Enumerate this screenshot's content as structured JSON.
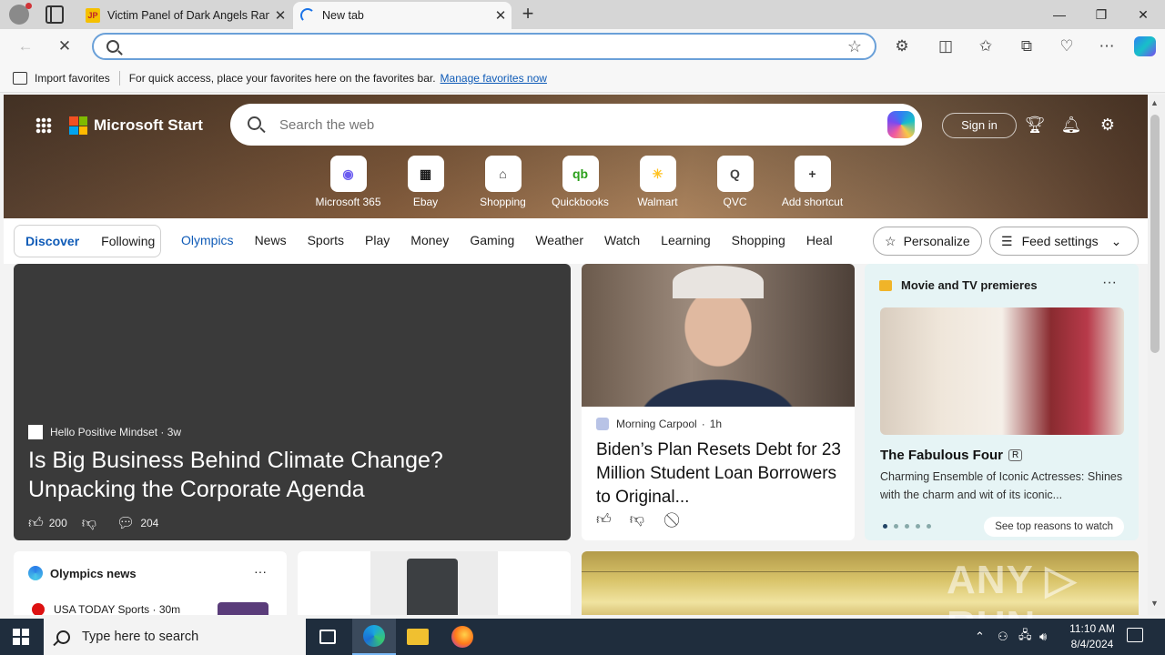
{
  "browser": {
    "tabs": [
      {
        "title": "Victim Panel of Dark Angels Ran",
        "favicon": "jp-favicon"
      },
      {
        "title": "New tab",
        "favicon": "loading-icon"
      }
    ],
    "address": {
      "value": "",
      "placeholder": ""
    },
    "favorites_bar": {
      "import_label": "Import favorites",
      "message": "For quick access, place your favorites here on the favorites bar.",
      "link": "Manage favorites now"
    }
  },
  "start": {
    "brand": "Microsoft Start",
    "search_placeholder": "Search the web",
    "sign_in": "Sign in",
    "shortcuts": [
      {
        "label": "Microsoft 365",
        "glyph": "◉",
        "color": "#6b5cf0"
      },
      {
        "label": "Ebay",
        "glyph": "▦",
        "color": "#1a1a1a"
      },
      {
        "label": "Shopping",
        "glyph": "⌂",
        "color": "#333333"
      },
      {
        "label": "Quickbooks",
        "glyph": "qb",
        "color": "#2ca01c"
      },
      {
        "label": "Walmart",
        "glyph": "✳",
        "color": "#ffc220"
      },
      {
        "label": "QVC",
        "glyph": "Q",
        "color": "#444444"
      },
      {
        "label": "Add shortcut",
        "glyph": "+",
        "color": "#333333"
      }
    ],
    "nav": {
      "discover": "Discover",
      "following": "Following",
      "links": [
        "Olympics",
        "News",
        "Sports",
        "Play",
        "Money",
        "Gaming",
        "Weather",
        "Watch",
        "Learning",
        "Shopping",
        "Heal"
      ],
      "personalize": "Personalize",
      "feed_settings": "Feed settings"
    },
    "lead_card": {
      "source": "Hello Positive Mindset · 3w",
      "title": "Is Big Business Behind Climate Change? Unpacking the Corporate Agenda",
      "likes": "200",
      "comments": "204"
    },
    "news_card": {
      "source": "Morning Carpool",
      "time": "1h",
      "title": "Biden’s Plan Resets Debt for 23 Million Student Loan Borrowers to Original..."
    },
    "movie_card": {
      "header": "Movie and TV premieres",
      "title": "The Fabulous Four",
      "rating": "R",
      "desc": "Charming Ensemble of Iconic Actresses: Shines with the charm and wit of its iconic...",
      "cta": "See top reasons to watch"
    },
    "olympics_card": {
      "header": "Olympics news",
      "item_source": "USA TODAY Sports · 30m"
    },
    "watermark": "ANY ▷ RUN"
  },
  "taskbar": {
    "search_placeholder": "Type here to search",
    "time": "11:10 AM",
    "date": "8/4/2024"
  }
}
